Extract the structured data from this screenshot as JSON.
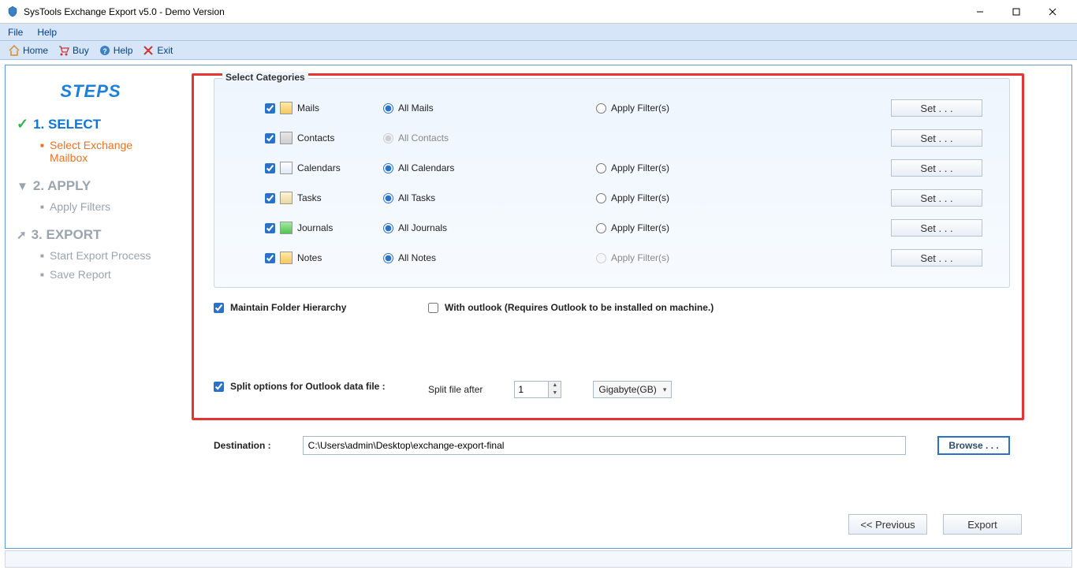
{
  "window": {
    "title": "SysTools Exchange Export v5.0 - Demo Version"
  },
  "menu": {
    "file": "File",
    "help": "Help"
  },
  "toolbar": {
    "home": "Home",
    "buy": "Buy",
    "help": "Help",
    "exit": "Exit"
  },
  "sidebar": {
    "heading": "STEPS",
    "step1": "1. SELECT",
    "step1a": "Select Exchange Mailbox",
    "step2": "2. APPLY",
    "step2a": "Apply Filters",
    "step3": "3. EXPORT",
    "step3a": "Start Export Process",
    "step3b": "Save Report"
  },
  "categories": {
    "legend": "Select Categories",
    "set_label": "Set . . .",
    "filter_label": "Apply Filter(s)",
    "rows": [
      {
        "name": "Mails",
        "all": "All Mails"
      },
      {
        "name": "Contacts",
        "all": "All Contacts"
      },
      {
        "name": "Calendars",
        "all": "All Calendars"
      },
      {
        "name": "Tasks",
        "all": "All Tasks"
      },
      {
        "name": "Journals",
        "all": "All Journals"
      },
      {
        "name": "Notes",
        "all": "All Notes"
      }
    ]
  },
  "options": {
    "maintain": "Maintain Folder Hierarchy",
    "with_outlook": "With outlook (Requires Outlook to be installed on machine.)",
    "split_label": "Split options for Outlook data file :",
    "split_after": "Split file after",
    "split_value": "1",
    "split_unit": "Gigabyte(GB)"
  },
  "destination": {
    "label": "Destination :",
    "path": "C:\\Users\\admin\\Desktop\\exchange-export-final",
    "browse": "Browse . . ."
  },
  "nav": {
    "prev": "<< Previous",
    "export": "Export"
  }
}
